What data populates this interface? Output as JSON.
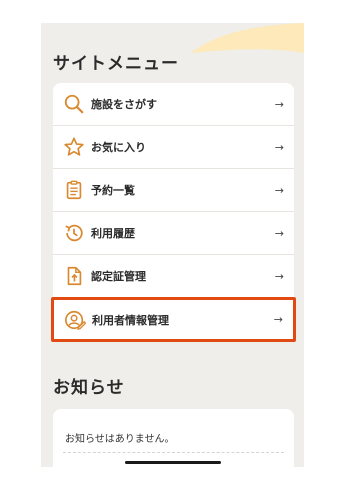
{
  "site_menu": {
    "title": "サイトメニュー",
    "arrow": "→",
    "items": [
      {
        "label": "施設をさがす",
        "icon": "search-icon"
      },
      {
        "label": "お気に入り",
        "icon": "star-icon"
      },
      {
        "label": "予約一覧",
        "icon": "clipboard-list-icon"
      },
      {
        "label": "利用履歴",
        "icon": "history-icon"
      },
      {
        "label": "認定証管理",
        "icon": "certificate-upload-icon"
      },
      {
        "label": "利用者情報管理",
        "icon": "user-edit-icon",
        "selected": true
      }
    ]
  },
  "notice": {
    "title": "お知らせ",
    "empty_message": "お知らせはありません。"
  },
  "colors": {
    "icon_accent": "#d9892f",
    "highlight_border": "#e24a14",
    "wave": "#fde9b9",
    "background": "#efeeea"
  }
}
